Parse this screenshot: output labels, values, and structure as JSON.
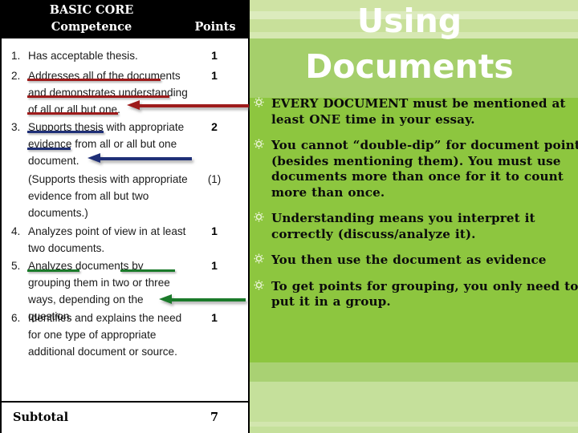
{
  "slide": {
    "title_line1": "Using",
    "title_line2": "Documents",
    "accent_green": "#8dc63f",
    "title_band_green": "#a5cf6b",
    "title_color": "#ffffff"
  },
  "bullets": [
    {
      "marker": "sun-bullet",
      "text": "EVERY DOCUMENT must be mentioned at least ONE time in your essay."
    },
    {
      "marker": "sun-bullet",
      "text": "You cannot “double-dip” for document points (besides mentioning them). You must use documents more than once for it to count more than once."
    },
    {
      "marker": "sun-bullet",
      "text": "Understanding means you interpret it correctly (discuss/analyze it)."
    },
    {
      "marker": "sun-bullet",
      "text": "You then use the document as evidence"
    },
    {
      "marker": "sun-bullet",
      "text": "To get points for grouping, you only need to put it in a group."
    }
  ],
  "rubric": {
    "header": {
      "competence_label": "BASIC CORE\nCompetence",
      "points_label": "Points"
    },
    "rows": [
      {
        "num": "1.",
        "text": "Has acceptable thesis.",
        "points": "1",
        "parenthetical": false
      },
      {
        "num": "2.",
        "text": "Addresses all of the documents and demonstrates understanding of all or all but one.",
        "points": "1",
        "parenthetical": false
      },
      {
        "num": "3.",
        "text": "Supports thesis with appropriate evidence from all or all but one document.",
        "points": "2",
        "parenthetical": false
      },
      {
        "num": "",
        "text": "(Supports thesis with appropriate evidence from all but two documents.)",
        "points": "(1)",
        "parenthetical": true
      },
      {
        "num": "4.",
        "text": "Analyzes point of view in at least two documents.",
        "points": "1",
        "parenthetical": false
      },
      {
        "num": "5.",
        "text": "Analyzes documents by grouping them in two or three ways, depending on the question.",
        "points": "1",
        "parenthetical": false
      },
      {
        "num": "6.",
        "text": "Identifies and explains the need for one type of appropriate additional document or source.",
        "points": "1",
        "parenthetical": false
      }
    ],
    "subtotal_label": "Subtotal",
    "subtotal_value": "7",
    "annotation_colors": {
      "red": "#9e1b1b",
      "navy": "#1f2f77",
      "green": "#1a7a2a"
    }
  }
}
